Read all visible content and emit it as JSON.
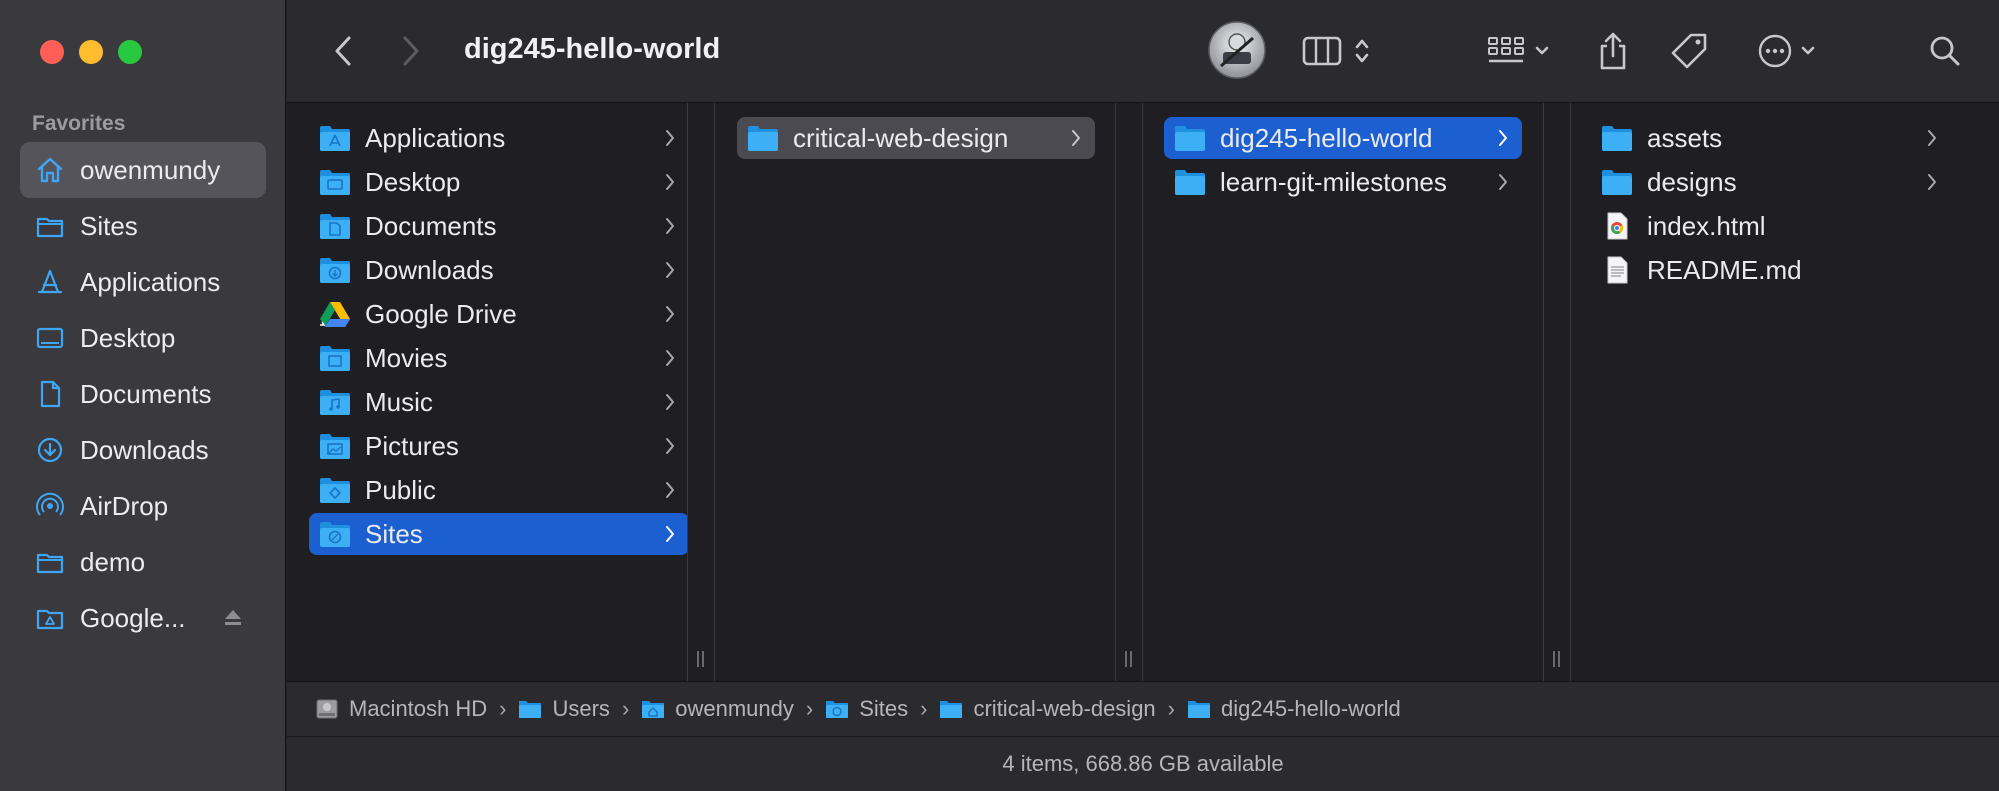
{
  "window": {
    "title": "dig245-hello-world"
  },
  "colors": {
    "accent": "#1b5fd1",
    "folder": "#37a9f0"
  },
  "sidebar": {
    "heading": "Favorites",
    "items": [
      {
        "label": "owenmundy",
        "icon": "home-icon",
        "active": true
      },
      {
        "label": "Sites",
        "icon": "folder-icon"
      },
      {
        "label": "Applications",
        "icon": "applications-icon"
      },
      {
        "label": "Desktop",
        "icon": "desktop-icon"
      },
      {
        "label": "Documents",
        "icon": "document-icon"
      },
      {
        "label": "Downloads",
        "icon": "downloads-icon"
      },
      {
        "label": "AirDrop",
        "icon": "airdrop-icon"
      },
      {
        "label": "demo",
        "icon": "folder-icon"
      },
      {
        "label": "Google...",
        "icon": "google-drive-folder-icon"
      }
    ]
  },
  "columns": [
    {
      "items": [
        {
          "label": "Applications",
          "icon": "folder-icon"
        },
        {
          "label": "Desktop",
          "icon": "folder-icon"
        },
        {
          "label": "Documents",
          "icon": "folder-icon"
        },
        {
          "label": "Downloads",
          "icon": "folder-icon"
        },
        {
          "label": "Google Drive",
          "icon": "google-drive-icon"
        },
        {
          "label": "Movies",
          "icon": "folder-icon"
        },
        {
          "label": "Music",
          "icon": "folder-icon"
        },
        {
          "label": "Pictures",
          "icon": "folder-icon"
        },
        {
          "label": "Public",
          "icon": "folder-icon"
        },
        {
          "label": "Sites",
          "icon": "folder-icon",
          "selected": true
        }
      ]
    },
    {
      "items": [
        {
          "label": "critical-web-design",
          "icon": "folder-icon",
          "selected": true
        }
      ]
    },
    {
      "items": [
        {
          "label": "dig245-hello-world",
          "icon": "folder-icon",
          "selected": true
        },
        {
          "label": "learn-git-milestones",
          "icon": "folder-icon"
        }
      ]
    },
    {
      "items": [
        {
          "label": "assets",
          "icon": "folder-icon"
        },
        {
          "label": "designs",
          "icon": "folder-icon"
        },
        {
          "label": "index.html",
          "icon": "html-file-icon"
        },
        {
          "label": "README.md",
          "icon": "text-file-icon"
        }
      ]
    }
  ],
  "pathbar": {
    "crumbs": [
      "Macintosh HD",
      "Users",
      "owenmundy",
      "Sites",
      "critical-web-design",
      "dig245-hello-world"
    ]
  },
  "status": {
    "text": "4 items, 668.86 GB available"
  }
}
